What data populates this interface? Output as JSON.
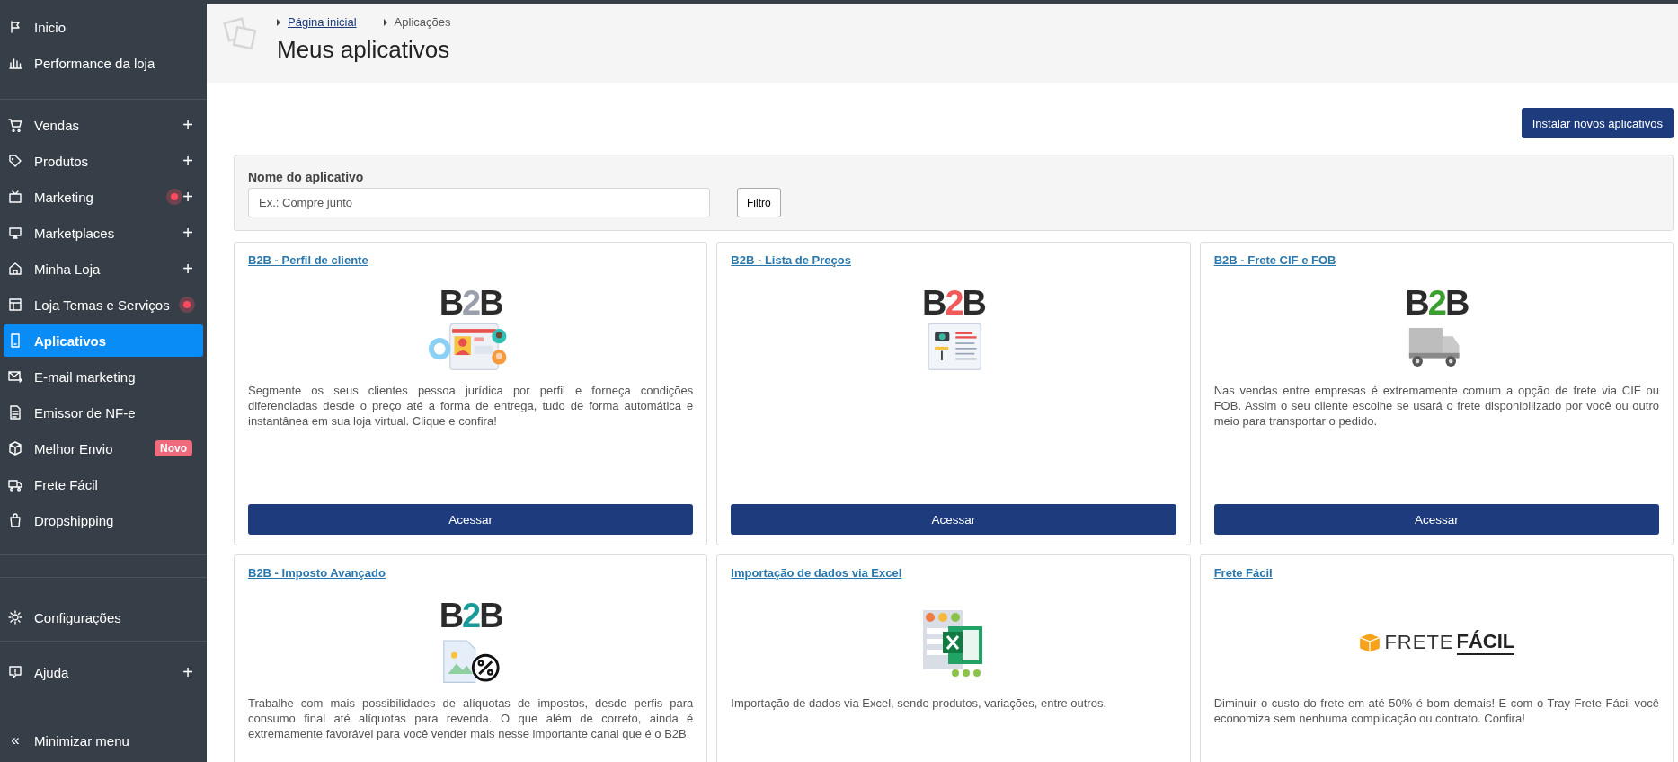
{
  "sidebar": {
    "groups": [
      {
        "items": [
          {
            "label": "Inicio",
            "selected": false
          },
          {
            "label": "Performance da loja",
            "selected": false
          }
        ]
      },
      {
        "items": [
          {
            "label": "Vendas",
            "selected": false,
            "expandable": "+"
          },
          {
            "label": "Produtos",
            "selected": false,
            "expandable": "+"
          },
          {
            "label": "Marketing",
            "selected": false,
            "expandable": "+",
            "notification": true
          },
          {
            "label": "Marketplaces",
            "selected": false,
            "expandable": "+"
          },
          {
            "label": "Minha Loja",
            "selected": false,
            "expandable": "+"
          },
          {
            "label": "Loja Temas e Serviços",
            "selected": false,
            "notification": true
          },
          {
            "label": "Aplicativos",
            "selected": true
          },
          {
            "label": "E-mail marketing",
            "selected": false
          },
          {
            "label": "Emissor de NF-e",
            "selected": false
          },
          {
            "label": "Melhor Envio",
            "selected": false,
            "badge": "Novo"
          },
          {
            "label": "Frete Fácil",
            "selected": false
          },
          {
            "label": "Dropshipping",
            "selected": false
          }
        ]
      },
      {
        "items": [
          {
            "label": "Configurações",
            "selected": false
          }
        ]
      },
      {
        "items": [
          {
            "label": "Ajuda",
            "selected": false,
            "expandable": "+"
          }
        ]
      }
    ],
    "collapse": {
      "glyph": "«",
      "label": "Minimizar menu"
    }
  },
  "breadcrumb": [
    {
      "label": "Página inicial",
      "link": true
    },
    {
      "label": "Aplicações",
      "link": false
    }
  ],
  "page_title": "Meus aplicativos",
  "install_button": "Instalar novos aplicativos",
  "filter": {
    "label": "Nome do aplicativo",
    "placeholder": "Ex.: Compre junto",
    "button": "Filtro"
  },
  "apps": [
    {
      "title": "B2B - Perfil de cliente",
      "logo": {
        "kind": "people",
        "parts": [
          "B",
          "2",
          "B"
        ],
        "color": "#9aa0ab"
      },
      "description": "Segmente os seus clientes pessoa jurídica por perfil e forneça condições diferenciadas desde o preço até a forma de entrega, tudo de forma automática e instantânea em sua loja virtual. Clique e confira!",
      "button": "Acessar"
    },
    {
      "title": "B2B - Lista de Preços",
      "logo": {
        "kind": "pricelist",
        "parts": [
          "B",
          "2",
          "B"
        ],
        "color": "#f25a5a"
      },
      "button": "Acessar"
    },
    {
      "title": "B2B - Frete CIF e FOB",
      "logo": {
        "kind": "truck",
        "parts": [
          "B",
          "2",
          "B"
        ],
        "color": "#3a9f2e"
      },
      "description": "Nas vendas entre empresas é extremamente comum a opção de frete via CIF ou FOB. Assim o seu cliente escolhe se usará o frete disponibilizado por você ou outro meio para transportar o pedido.",
      "button": "Acessar"
    },
    {
      "title": "B2B - Imposto Avançado",
      "logo": {
        "kind": "tax",
        "parts": [
          "B",
          "2",
          "B"
        ],
        "color": "#1a9a9a"
      },
      "description": "Trabalhe com mais possibilidades de alíquotas de impostos, desde perfis para consumo final até alíquotas para revenda. O que além de correto, ainda é extremamente favorável para você vender mais nesse importante canal que é o B2B."
    },
    {
      "title": "Importação de dados via Excel",
      "logo": {
        "kind": "excel"
      },
      "description": "Importação de dados via Excel, sendo produtos, variações, entre outros."
    },
    {
      "title": "Frete Fácil",
      "logo": {
        "kind": "frete",
        "parts": [
          "FRETE",
          "FÁCIL"
        ]
      },
      "description": "Diminuir o custo do frete em até 50% é bom demais! E com o Tray Frete Fácil você economiza sem nenhuma complicação ou contrato. Confira!"
    }
  ]
}
